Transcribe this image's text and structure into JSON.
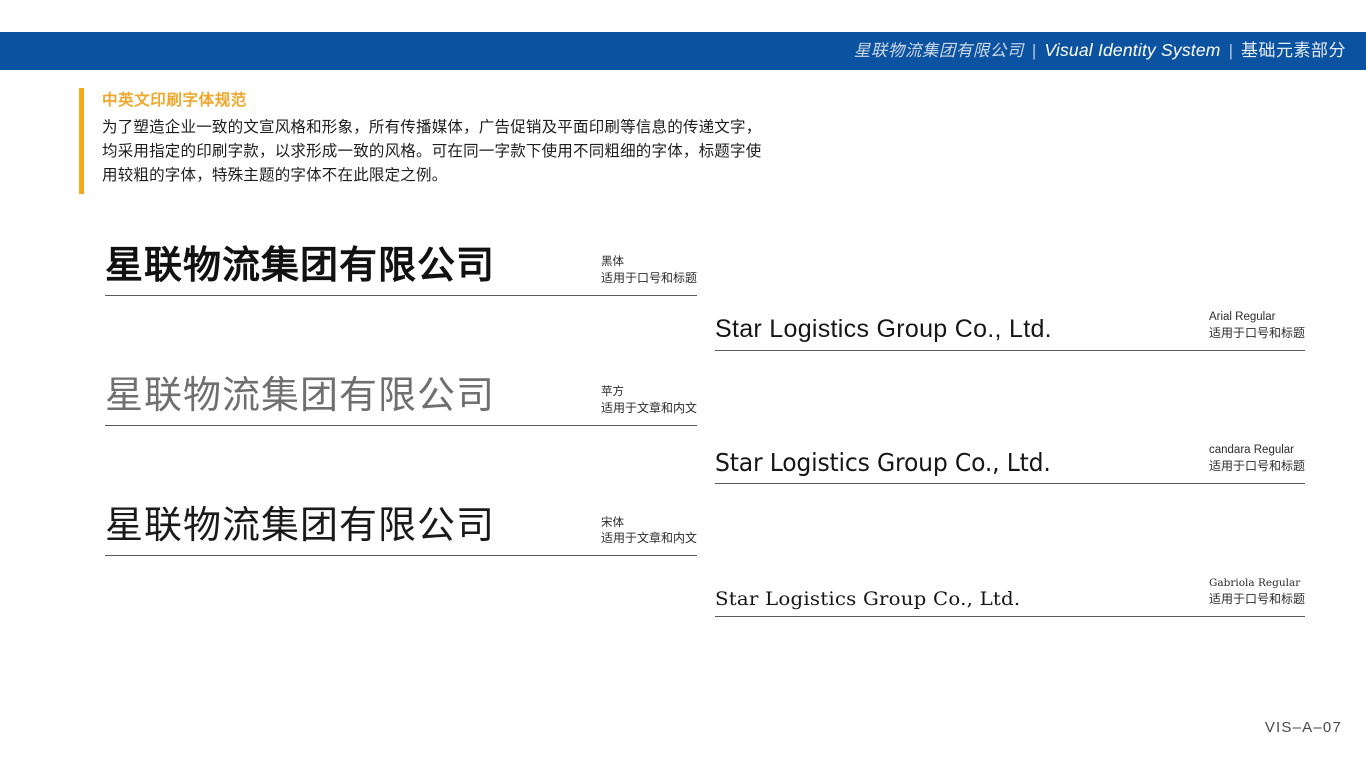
{
  "header": {
    "company_cn": "星联物流集团有限公司",
    "separator": "|",
    "system_en": "Visual Identity System",
    "section_cn": "基础元素部分",
    "bar_color": "#0b52a0"
  },
  "section": {
    "title": "中英文印刷字体规范",
    "accent_color": "#f5a81c",
    "body_line1": "为了塑造企业一致的文宣风格和形象，所有传播媒体，广告促销及平面印刷等信息的传递文字，",
    "body_line2": "均采用指定的印刷字款，以求形成一致的风格。可在同一字款下使用不同粗细的字体，标题字使",
    "body_line3": "用较粗的字体，特殊主题的字体不在此限定之例。"
  },
  "specimens_cn": [
    {
      "sample": "星联物流集团有限公司",
      "font_name": "黑体",
      "usage": "适用于口号和标题"
    },
    {
      "sample": "星联物流集团有限公司",
      "font_name": "苹方",
      "usage": "适用于文章和内文"
    },
    {
      "sample": "星联物流集团有限公司",
      "font_name": "宋体",
      "usage": "适用于文章和内文"
    }
  ],
  "specimens_en": [
    {
      "sample": "Star Logistics Group Co., Ltd.",
      "font_name": "Arial Regular",
      "usage": "适用于口号和标题"
    },
    {
      "sample": "Star Logistics Group Co., Ltd.",
      "font_name": "candara Regular",
      "usage": "适用于口号和标题"
    },
    {
      "sample": "Star Logistics Group Co., Ltd.",
      "font_name": "Gabriola Regular",
      "usage": "适用于口号和标题"
    }
  ],
  "footer": {
    "page_code": "VIS–A–07"
  }
}
